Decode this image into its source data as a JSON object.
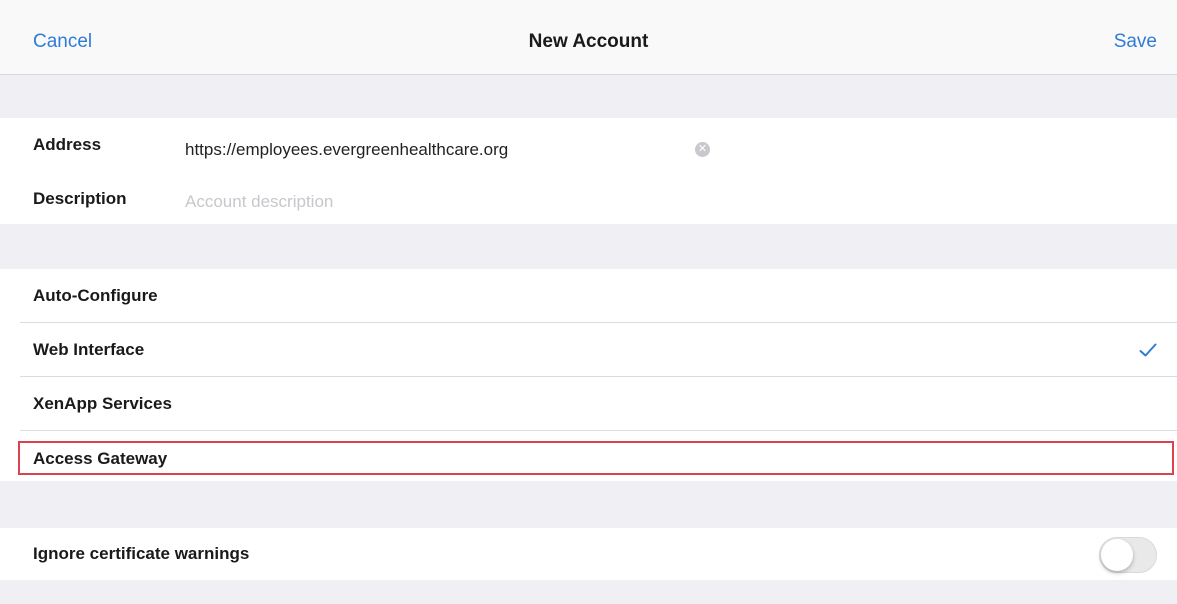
{
  "navbar": {
    "cancel_label": "Cancel",
    "title": "New Account",
    "save_label": "Save"
  },
  "fields": {
    "address": {
      "label": "Address",
      "value": "https://employees.evergreenhealthcare.org"
    },
    "description": {
      "label": "Description",
      "value": "",
      "placeholder": "Account description"
    }
  },
  "account_types": [
    {
      "label": "Auto-Configure",
      "selected": false
    },
    {
      "label": "Web Interface",
      "selected": true
    },
    {
      "label": "XenApp Services",
      "selected": false
    },
    {
      "label": "Access Gateway",
      "selected": false,
      "highlighted": true
    }
  ],
  "settings": {
    "ignore_cert_label": "Ignore certificate warnings",
    "ignore_cert_enabled": false
  },
  "colors": {
    "accent": "#2f7cd6",
    "highlight": "#d9434f",
    "background": "#efeff4"
  },
  "icons": {
    "clear": "clear-text-icon",
    "selected": "checkmark-icon"
  }
}
